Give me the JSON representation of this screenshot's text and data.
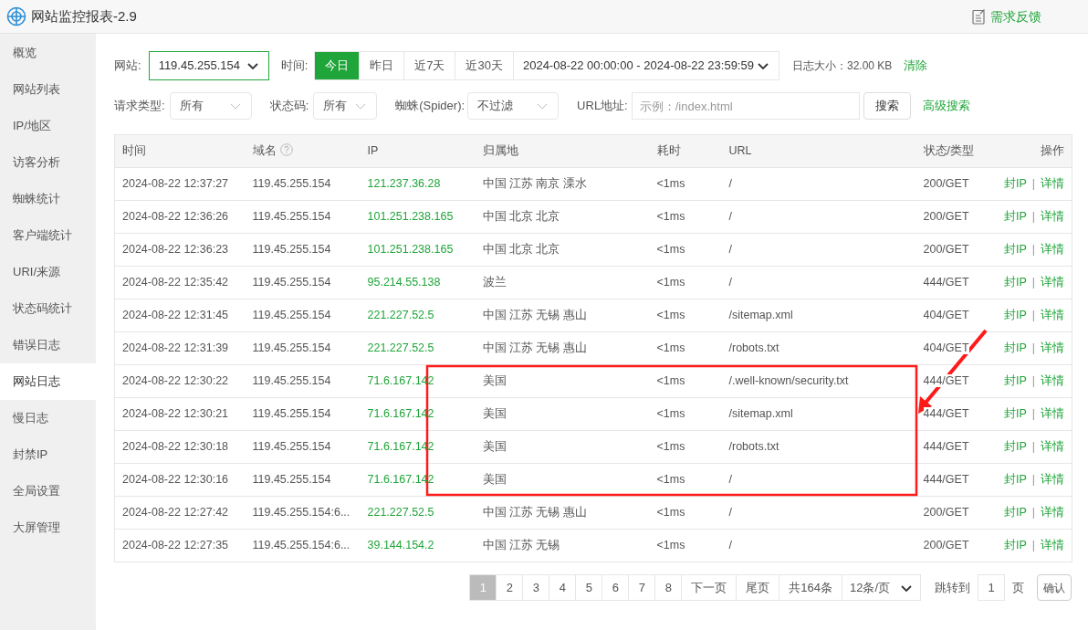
{
  "window": {
    "title": "网站监控报表-2.9",
    "feedback": "需求反馈"
  },
  "sidebar": {
    "items": [
      {
        "label": "概览",
        "selected": false
      },
      {
        "label": "网站列表",
        "selected": false
      },
      {
        "label": "IP/地区",
        "selected": false
      },
      {
        "label": "访客分析",
        "selected": false
      },
      {
        "label": "蜘蛛统计",
        "selected": false
      },
      {
        "label": "客户端统计",
        "selected": false
      },
      {
        "label": "URI/来源",
        "selected": false
      },
      {
        "label": "状态码统计",
        "selected": false
      },
      {
        "label": "错误日志",
        "selected": false
      },
      {
        "label": "网站日志",
        "selected": true
      },
      {
        "label": "慢日志",
        "selected": false
      },
      {
        "label": "封禁IP",
        "selected": false
      },
      {
        "label": "全局设置",
        "selected": false
      },
      {
        "label": "大屏管理",
        "selected": false
      }
    ]
  },
  "filters": {
    "site_label": "网站:",
    "site_value": "119.45.255.154",
    "time_label": "时间:",
    "time_ranges": [
      {
        "label": "今日",
        "selected": true
      },
      {
        "label": "昨日",
        "selected": false
      },
      {
        "label": "近7天",
        "selected": false
      },
      {
        "label": "近30天",
        "selected": false
      }
    ],
    "date_range": "2024-08-22 00:00:00 - 2024-08-22 23:59:59",
    "log_size": "日志大小：32.00 KB",
    "clear": "清除",
    "request_type_label": "请求类型:",
    "request_type_value": "所有",
    "status_label": "状态码:",
    "status_value": "所有",
    "spider_label": "蜘蛛(Spider):",
    "spider_value": "不过滤",
    "url_label": "URL地址:",
    "url_placeholder": "示例：/index.html",
    "search": "搜索",
    "advanced_search": "高级搜索"
  },
  "table": {
    "columns": [
      "时间",
      "域名",
      "IP",
      "归属地",
      "耗时",
      "URL",
      "状态/类型",
      "操作"
    ],
    "rows": [
      {
        "time": "2024-08-22 12:37:27",
        "domain": "119.45.255.154",
        "ip": "121.237.36.28",
        "location": "中国 江苏 南京 溧水",
        "duration": "<1ms",
        "url": "/",
        "status": "200/GET",
        "ops": [
          "封IP",
          "|",
          "详情"
        ]
      },
      {
        "time": "2024-08-22 12:36:26",
        "domain": "119.45.255.154",
        "ip": "101.251.238.165",
        "location": "中国 北京 北京",
        "duration": "<1ms",
        "url": "/",
        "status": "200/GET",
        "ops": [
          "封IP",
          "|",
          "详情"
        ]
      },
      {
        "time": "2024-08-22 12:36:23",
        "domain": "119.45.255.154",
        "ip": "101.251.238.165",
        "location": "中国 北京 北京",
        "duration": "<1ms",
        "url": "/",
        "status": "200/GET",
        "ops": [
          "封IP",
          "|",
          "详情"
        ]
      },
      {
        "time": "2024-08-22 12:35:42",
        "domain": "119.45.255.154",
        "ip": "95.214.55.138",
        "location": "波兰",
        "duration": "<1ms",
        "url": "/",
        "status": "444/GET",
        "ops": [
          "封IP",
          "|",
          "详情"
        ]
      },
      {
        "time": "2024-08-22 12:31:45",
        "domain": "119.45.255.154",
        "ip": "221.227.52.5",
        "location": "中国 江苏 无锡 惠山",
        "duration": "<1ms",
        "url": "/sitemap.xml",
        "status": "404/GET",
        "ops": [
          "封IP",
          "|",
          "详情"
        ]
      },
      {
        "time": "2024-08-22 12:31:39",
        "domain": "119.45.255.154",
        "ip": "221.227.52.5",
        "location": "中国 江苏 无锡 惠山",
        "duration": "<1ms",
        "url": "/robots.txt",
        "status": "404/GET",
        "ops": [
          "封IP",
          "|",
          "详情"
        ]
      },
      {
        "time": "2024-08-22 12:30:22",
        "domain": "119.45.255.154",
        "ip": "71.6.167.142",
        "location": "美国",
        "duration": "<1ms",
        "url": "/.well-known/security.txt",
        "status": "444/GET",
        "ops": [
          "封IP",
          "|",
          "详情"
        ]
      },
      {
        "time": "2024-08-22 12:30:21",
        "domain": "119.45.255.154",
        "ip": "71.6.167.142",
        "location": "美国",
        "duration": "<1ms",
        "url": "/sitemap.xml",
        "status": "444/GET",
        "ops": [
          "封IP",
          "|",
          "详情"
        ]
      },
      {
        "time": "2024-08-22 12:30:18",
        "domain": "119.45.255.154",
        "ip": "71.6.167.142",
        "location": "美国",
        "duration": "<1ms",
        "url": "/robots.txt",
        "status": "444/GET",
        "ops": [
          "封IP",
          "|",
          "详情"
        ]
      },
      {
        "time": "2024-08-22 12:30:16",
        "domain": "119.45.255.154",
        "ip": "71.6.167.142",
        "location": "美国",
        "duration": "<1ms",
        "url": "/",
        "status": "444/GET",
        "ops": [
          "封IP",
          "|",
          "详情"
        ]
      },
      {
        "time": "2024-08-22 12:27:42",
        "domain": "119.45.255.154:6...",
        "ip": "221.227.52.5",
        "location": "中国 江苏 无锡 惠山",
        "duration": "<1ms",
        "url": "/",
        "status": "200/GET",
        "ops": [
          "封IP",
          "|",
          "详情"
        ]
      },
      {
        "time": "2024-08-22 12:27:35",
        "domain": "119.45.255.154:6...",
        "ip": "39.144.154.2",
        "location": "中国 江苏 无锡",
        "duration": "<1ms",
        "url": "/",
        "status": "200/GET",
        "ops": [
          "封IP",
          "|",
          "详情"
        ]
      }
    ]
  },
  "pagination": {
    "pages": [
      {
        "label": "1",
        "selected": true
      },
      {
        "label": "2",
        "selected": false
      },
      {
        "label": "3",
        "selected": false
      },
      {
        "label": "4",
        "selected": false
      },
      {
        "label": "5",
        "selected": false
      },
      {
        "label": "6",
        "selected": false
      },
      {
        "label": "7",
        "selected": false
      },
      {
        "label": "8",
        "selected": false
      }
    ],
    "next": "下一页",
    "last": "尾页",
    "total": "共164条",
    "page_size": "12条/页",
    "jump_label": "跳转到",
    "jump_value": "1",
    "page_unit": "页",
    "confirm": "确认"
  },
  "annotation": {
    "kind": "highlight"
  }
}
